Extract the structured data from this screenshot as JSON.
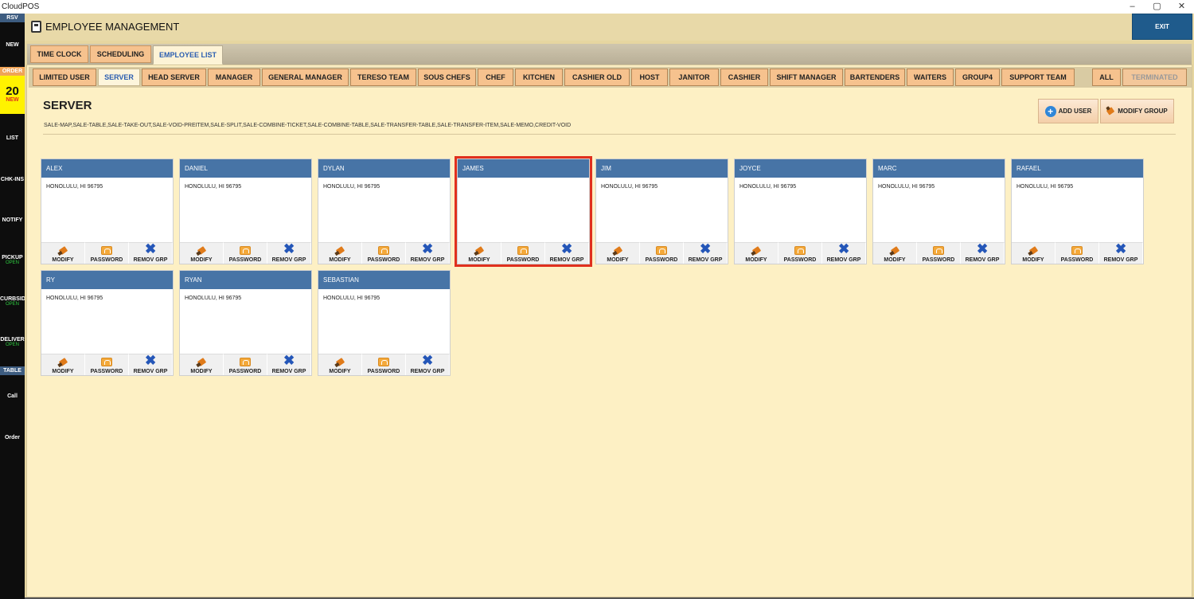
{
  "window": {
    "app_title": "CloudPOS",
    "controls": [
      "–",
      "▢",
      "✕"
    ]
  },
  "leftbar": {
    "rsv": "RSV",
    "new": "NEW",
    "order_band": "ORDER",
    "order_count": "20",
    "order_new": "NEW",
    "list": "LIST",
    "chkins": "CHK-INS",
    "notify": "NOTIFY",
    "pickup": "PICKUP",
    "pickup_status": "OPEN",
    "curbside": "CURBSID",
    "curbside_status": "OPEN",
    "delivery": "DELIVER",
    "delivery_status": "OPEN",
    "table_band": "TABLE",
    "call": "Call",
    "order": "Order"
  },
  "header": {
    "title": "EMPLOYEE MANAGEMENT",
    "exit_label": "EXIT"
  },
  "main_tabs": [
    {
      "label": "TIME CLOCK"
    },
    {
      "label": "SCHEDULING"
    },
    {
      "label": "EMPLOYEE LIST"
    }
  ],
  "group_tabs": [
    {
      "label": "LIMITED USER"
    },
    {
      "label": "SERVER"
    },
    {
      "label": "HEAD SERVER"
    },
    {
      "label": "MANAGER"
    },
    {
      "label": "GENERAL MANAGER"
    },
    {
      "label": "TERESO TEAM"
    },
    {
      "label": "SOUS CHEFS"
    },
    {
      "label": "CHEF"
    },
    {
      "label": "KITCHEN"
    },
    {
      "label": "CASHIER OLD"
    },
    {
      "label": "HOST"
    },
    {
      "label": "JANITOR"
    },
    {
      "label": "CASHIER"
    },
    {
      "label": "SHIFT MANAGER"
    },
    {
      "label": "BARTENDERS"
    },
    {
      "label": "WAITERS"
    },
    {
      "label": "GROUP4"
    },
    {
      "label": "SUPPORT TEAM"
    },
    {
      "label": "ALL"
    },
    {
      "label": "TERMINATED"
    }
  ],
  "group": {
    "title": "SERVER",
    "permissions": "SALE-MAP,SALE-TABLE,SALE-TAKE-OUT,SALE-VOID-PREITEM,SALE-SPLIT,SALE-COMBINE-TICKET,SALE-COMBINE-TABLE,SALE-TRANSFER-TABLE,SALE-TRANSFER-ITEM,SALE-MEMO,CREDIT-VOID",
    "add_user_label": "ADD USER",
    "modify_group_label": "MODIFY GROUP"
  },
  "card_actions": {
    "modify": "MODIFY",
    "password": "PASSWORD",
    "remove": "REMOV GRP"
  },
  "employees": [
    {
      "name": "ALEX",
      "address": "HONOLULU, HI 96795"
    },
    {
      "name": "DANIEL",
      "address": "HONOLULU, HI 96795"
    },
    {
      "name": "DYLAN",
      "address": "HONOLULU, HI 96795"
    },
    {
      "name": "JAMES",
      "address": ""
    },
    {
      "name": "JIM",
      "address": "HONOLULU, HI 96795"
    },
    {
      "name": "JOYCE",
      "address": "HONOLULU, HI 96795"
    },
    {
      "name": "MARC",
      "address": "HONOLULU, HI 96795"
    },
    {
      "name": "RAFAEL",
      "address": "HONOLULU, HI 96795"
    },
    {
      "name": "RY",
      "address": "HONOLULU, HI 96795"
    },
    {
      "name": "RYAN",
      "address": "HONOLULU, HI 96795"
    },
    {
      "name": "SEBASTIAN",
      "address": "HONOLULU, HI 96795"
    }
  ],
  "colors": {
    "accent_blue": "#4774a6",
    "tab_orange": "#f6c28e",
    "selected_border": "#e0301e",
    "panel_bg": "#fdf0c4"
  }
}
